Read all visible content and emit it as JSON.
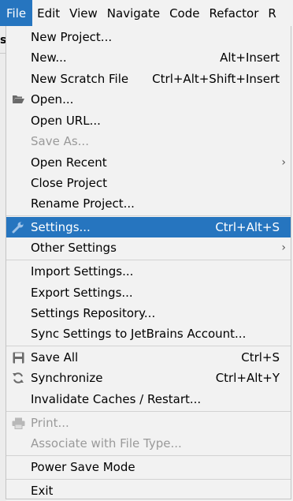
{
  "menubar": {
    "items": [
      "File",
      "Edit",
      "View",
      "Navigate",
      "Code",
      "Refactor",
      "R"
    ]
  },
  "background": {
    "fragment": "s"
  },
  "file_menu": {
    "items": [
      {
        "label": "New Project...",
        "shortcut": "",
        "icon": "",
        "submenu": false,
        "disabled": false
      },
      {
        "label": "New...",
        "shortcut": "Alt+Insert",
        "icon": "",
        "submenu": false,
        "disabled": false
      },
      {
        "label": "New Scratch File",
        "shortcut": "Ctrl+Alt+Shift+Insert",
        "icon": "",
        "submenu": false,
        "disabled": false
      },
      {
        "label": "Open...",
        "shortcut": "",
        "icon": "folder-icon",
        "submenu": false,
        "disabled": false
      },
      {
        "label": "Open URL...",
        "shortcut": "",
        "icon": "",
        "submenu": false,
        "disabled": false
      },
      {
        "label": "Save As...",
        "shortcut": "",
        "icon": "",
        "submenu": false,
        "disabled": true
      },
      {
        "label": "Open Recent",
        "shortcut": "",
        "icon": "",
        "submenu": true,
        "disabled": false
      },
      {
        "label": "Close Project",
        "shortcut": "",
        "icon": "",
        "submenu": false,
        "disabled": false
      },
      {
        "label": "Rename Project...",
        "shortcut": "",
        "icon": "",
        "submenu": false,
        "disabled": false
      },
      {
        "label": "Settings...",
        "shortcut": "Ctrl+Alt+S",
        "icon": "wrench-icon",
        "submenu": false,
        "disabled": false,
        "selected": true
      },
      {
        "label": "Other Settings",
        "shortcut": "",
        "icon": "",
        "submenu": true,
        "disabled": false
      },
      {
        "label": "Import Settings...",
        "shortcut": "",
        "icon": "",
        "submenu": false,
        "disabled": false
      },
      {
        "label": "Export Settings...",
        "shortcut": "",
        "icon": "",
        "submenu": false,
        "disabled": false
      },
      {
        "label": "Settings Repository...",
        "shortcut": "",
        "icon": "",
        "submenu": false,
        "disabled": false
      },
      {
        "label": "Sync Settings to JetBrains Account...",
        "shortcut": "",
        "icon": "",
        "submenu": false,
        "disabled": false
      },
      {
        "label": "Save All",
        "shortcut": "Ctrl+S",
        "icon": "save-icon",
        "submenu": false,
        "disabled": false
      },
      {
        "label": "Synchronize",
        "shortcut": "Ctrl+Alt+Y",
        "icon": "refresh-icon",
        "submenu": false,
        "disabled": false
      },
      {
        "label": "Invalidate Caches / Restart...",
        "shortcut": "",
        "icon": "",
        "submenu": false,
        "disabled": false
      },
      {
        "label": "Print...",
        "shortcut": "",
        "icon": "printer-icon",
        "submenu": false,
        "disabled": true
      },
      {
        "label": "Associate with File Type...",
        "shortcut": "",
        "icon": "",
        "submenu": false,
        "disabled": true
      },
      {
        "label": "Power Save Mode",
        "shortcut": "",
        "icon": "",
        "submenu": false,
        "disabled": false
      },
      {
        "label": "Exit",
        "shortcut": "",
        "icon": "",
        "submenu": false,
        "disabled": false
      }
    ]
  },
  "colors": {
    "selection": "#2675bf",
    "menu_background": "#f2f2f2",
    "disabled_text": "#9a9a9a"
  }
}
